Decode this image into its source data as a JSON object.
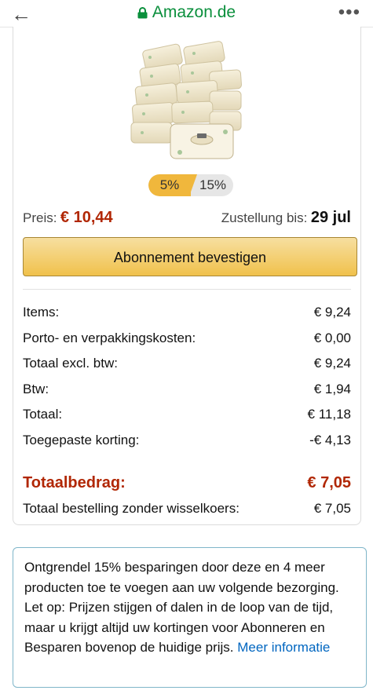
{
  "browser": {
    "back_icon": "arrow-left-icon",
    "url": "Amazon.de",
    "lock_icon": "lock-icon",
    "more_icon": "more-dots-icon"
  },
  "product": {
    "image": "baby-wipes-packs-image",
    "discount_tiers": [
      "5%",
      "15%"
    ],
    "price_label": "Preis:",
    "price": "€ 10,44",
    "delivery_label": "Zustellung bis:",
    "delivery_date": "29 jul"
  },
  "confirm_button": "Abonnement bevestigen",
  "summary": {
    "rows": [
      {
        "label": "Items:",
        "value": "€ 9,24"
      },
      {
        "label": "Porto- en verpakkingskosten:",
        "value": "€ 0,00"
      },
      {
        "label": "Totaal excl. btw:",
        "value": "€ 9,24"
      },
      {
        "label": "Btw:",
        "value": "€ 1,94"
      },
      {
        "label": "Totaal:",
        "value": "€ 11,18"
      },
      {
        "label": "Toegepaste korting:",
        "value": "-€ 4,13"
      }
    ],
    "total_label": "Totaalbedrag:",
    "total_value": "€ 7,05",
    "nofx_label": "Totaal bestelling zonder wisselkoers:",
    "nofx_value": "€ 7,05"
  },
  "info": {
    "text": "Ontgrendel 15% besparingen door deze en 4 meer producten toe te voegen aan uw volgende bezorging. Let op: Prijzen stijgen of dalen in de loop van de tijd, maar u krijgt altijd uw kortingen voor Abonneren en Besparen bovenop de huidige prijs.",
    "link": "Meer informatie"
  },
  "colors": {
    "url_green": "#0a8f3c",
    "price_red": "#b12704",
    "button_yellow": "#f0c14b",
    "tier_orange": "#f0b73c",
    "link_blue": "#0066c0",
    "info_border": "#7fb6c9"
  }
}
